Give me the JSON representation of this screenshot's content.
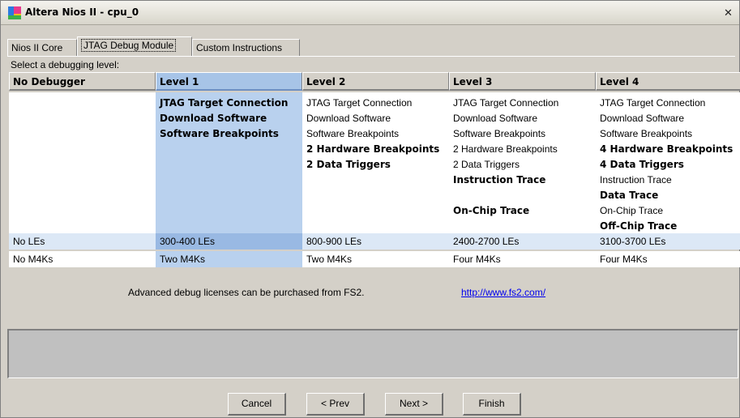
{
  "window": {
    "title": "Altera Nios II - cpu_0",
    "close_label": "✕"
  },
  "tabs": [
    {
      "label": "Nios II Core"
    },
    {
      "label": "JTAG Debug Module",
      "active": true
    },
    {
      "label": "Custom Instructions"
    }
  ],
  "section_label": "Select a debugging level:",
  "levels": [
    {
      "name": "No Debugger",
      "selected": false,
      "features": [],
      "les": "No LEs",
      "m4ks": "No M4Ks"
    },
    {
      "name": "Level 1",
      "selected": true,
      "features": [
        {
          "text": "JTAG Target Connection",
          "bold": true
        },
        {
          "text": "Download Software",
          "bold": true
        },
        {
          "text": "Software Breakpoints",
          "bold": true
        }
      ],
      "les": "300-400 LEs",
      "m4ks": "Two M4Ks"
    },
    {
      "name": "Level 2",
      "selected": false,
      "features": [
        {
          "text": "JTAG Target Connection",
          "bold": false
        },
        {
          "text": "Download Software",
          "bold": false
        },
        {
          "text": "Software Breakpoints",
          "bold": false
        },
        {
          "text": "2 Hardware Breakpoints",
          "bold": true
        },
        {
          "text": "2 Data Triggers",
          "bold": true
        }
      ],
      "les": "800-900 LEs",
      "m4ks": "Two M4Ks"
    },
    {
      "name": "Level 3",
      "selected": false,
      "features": [
        {
          "text": "JTAG Target Connection",
          "bold": false
        },
        {
          "text": "Download Software",
          "bold": false
        },
        {
          "text": "Software Breakpoints",
          "bold": false
        },
        {
          "text": "2 Hardware Breakpoints",
          "bold": false
        },
        {
          "text": "2 Data Triggers",
          "bold": false
        },
        {
          "text": "Instruction Trace",
          "bold": true
        },
        {
          "text": "",
          "bold": false
        },
        {
          "text": "On-Chip Trace",
          "bold": true
        }
      ],
      "les": "2400-2700 LEs",
      "m4ks": "Four M4Ks"
    },
    {
      "name": "Level 4",
      "selected": false,
      "features": [
        {
          "text": "JTAG Target Connection",
          "bold": false
        },
        {
          "text": "Download Software",
          "bold": false
        },
        {
          "text": "Software Breakpoints",
          "bold": false
        },
        {
          "text": "4 Hardware Breakpoints",
          "bold": true
        },
        {
          "text": "4 Data Triggers",
          "bold": true
        },
        {
          "text": "Instruction Trace",
          "bold": false
        },
        {
          "text": "Data Trace",
          "bold": true
        },
        {
          "text": "On-Chip Trace",
          "bold": false
        },
        {
          "text": "Off-Chip Trace",
          "bold": true
        }
      ],
      "les": "3100-3700 LEs",
      "m4ks": "Four M4Ks"
    }
  ],
  "license": {
    "text": "Advanced debug licenses can be purchased from FS2.",
    "link": "http://www.fs2.com/"
  },
  "buttons": {
    "cancel": "Cancel",
    "prev": "< Prev",
    "next": "Next >",
    "finish": "Finish"
  }
}
